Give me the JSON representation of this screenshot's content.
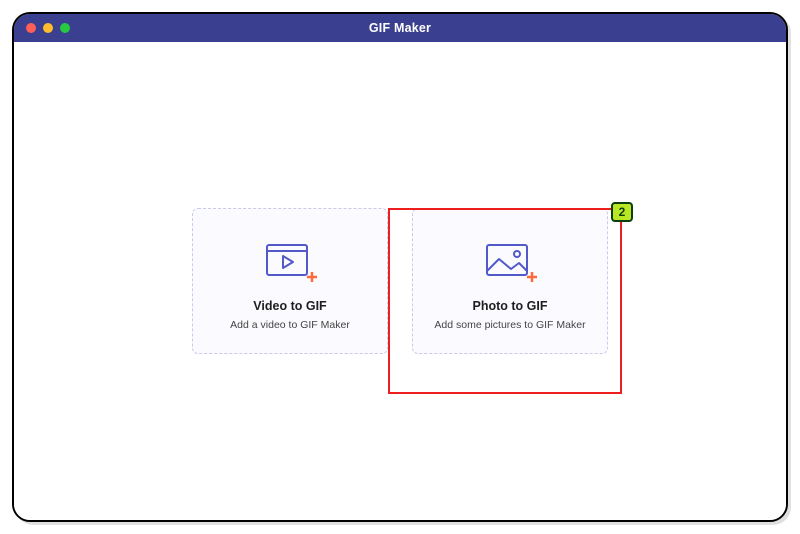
{
  "window": {
    "title": "GIF Maker"
  },
  "cards": {
    "video": {
      "title": "Video to GIF",
      "subtitle": "Add a video to GIF Maker"
    },
    "photo": {
      "title": "Photo to GIF",
      "subtitle": "Add some pictures to GIF Maker"
    }
  },
  "annotation": {
    "badge": "2"
  },
  "colors": {
    "titlebar": "#3b3f8f",
    "icon_stroke": "#5259c9",
    "icon_plus": "#ff6a3d",
    "highlight": "#ef1e1e",
    "badge_bg": "#b8e726",
    "badge_fg": "#0e3d0e"
  }
}
